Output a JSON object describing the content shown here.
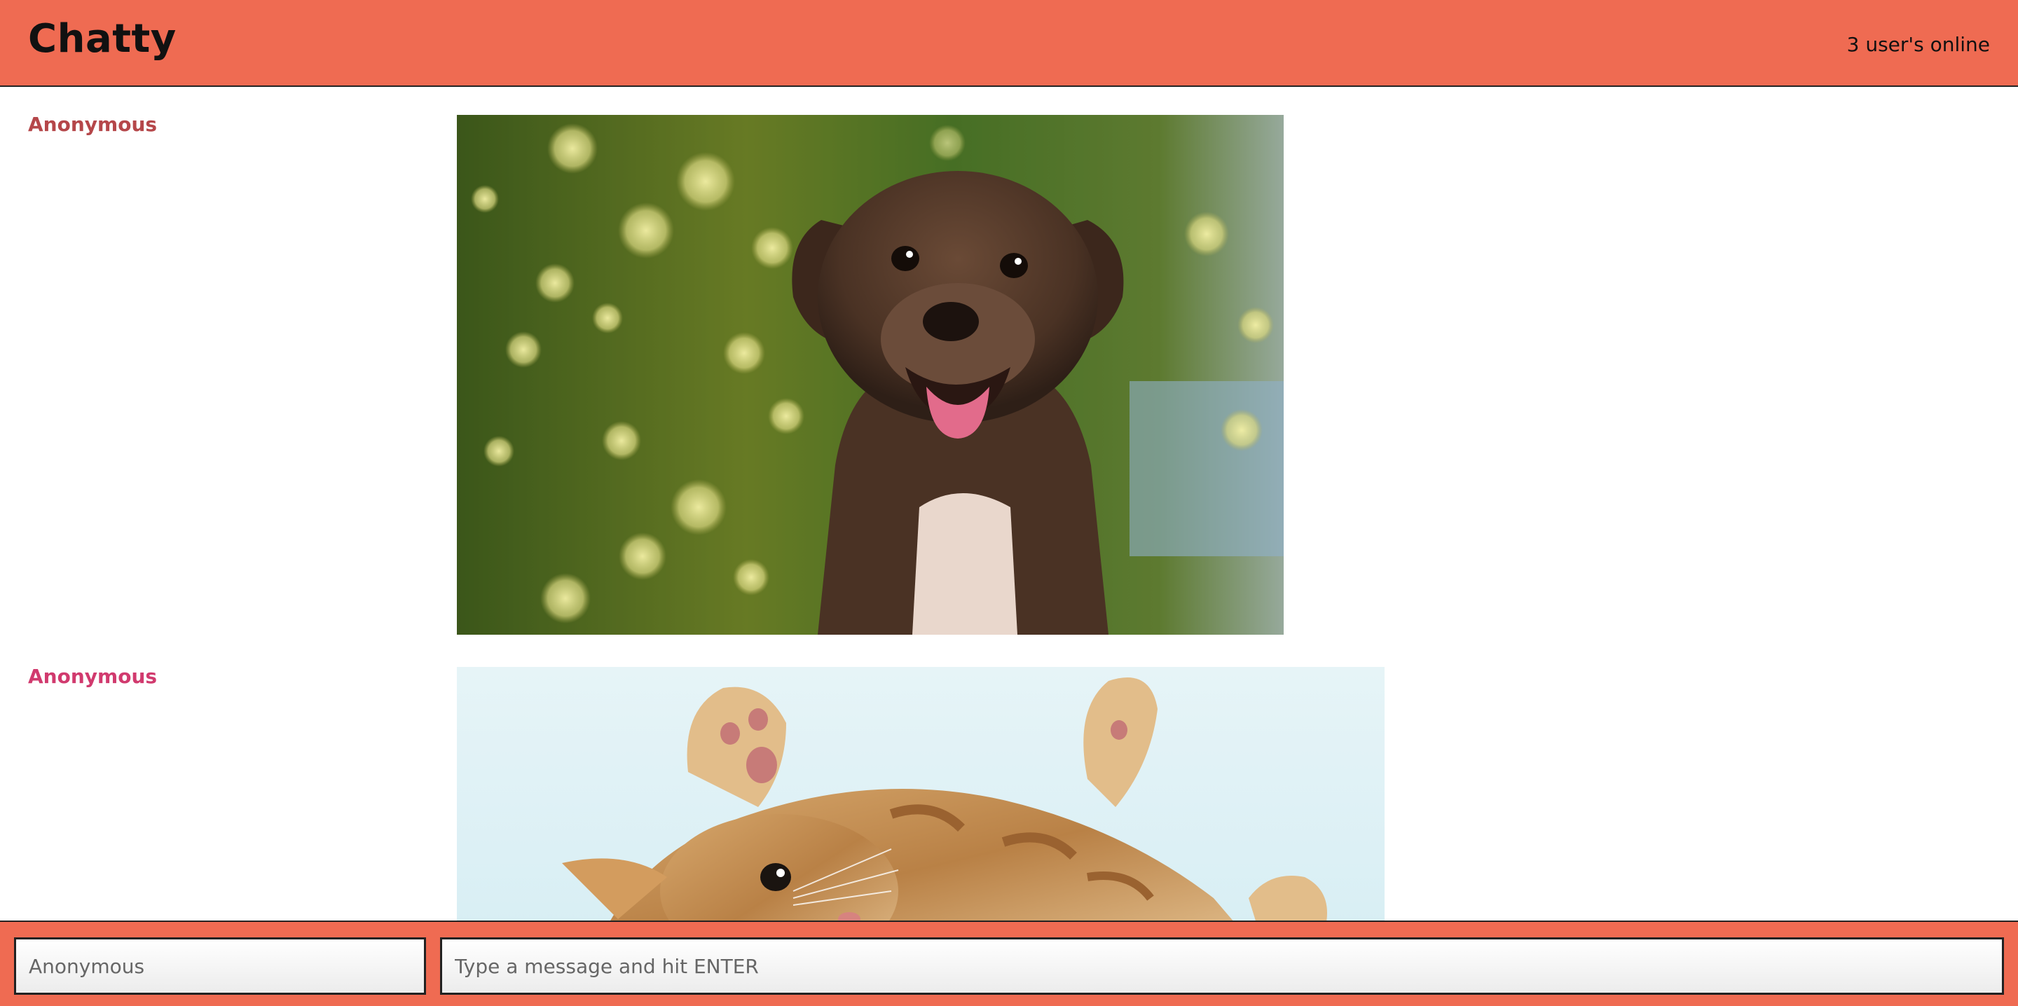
{
  "navbar": {
    "brand": "Chatty",
    "users_online": "3 user's online"
  },
  "messages": [
    {
      "username": "Anonymous",
      "username_color": "#b5474a",
      "image": "puppy"
    },
    {
      "username": "Anonymous",
      "username_color": "#d13a6e",
      "image": "kitten"
    }
  ],
  "composer": {
    "username_placeholder": "Anonymous",
    "message_placeholder": "Type a message and hit ENTER"
  },
  "colors": {
    "accent": "#ef6b52"
  }
}
